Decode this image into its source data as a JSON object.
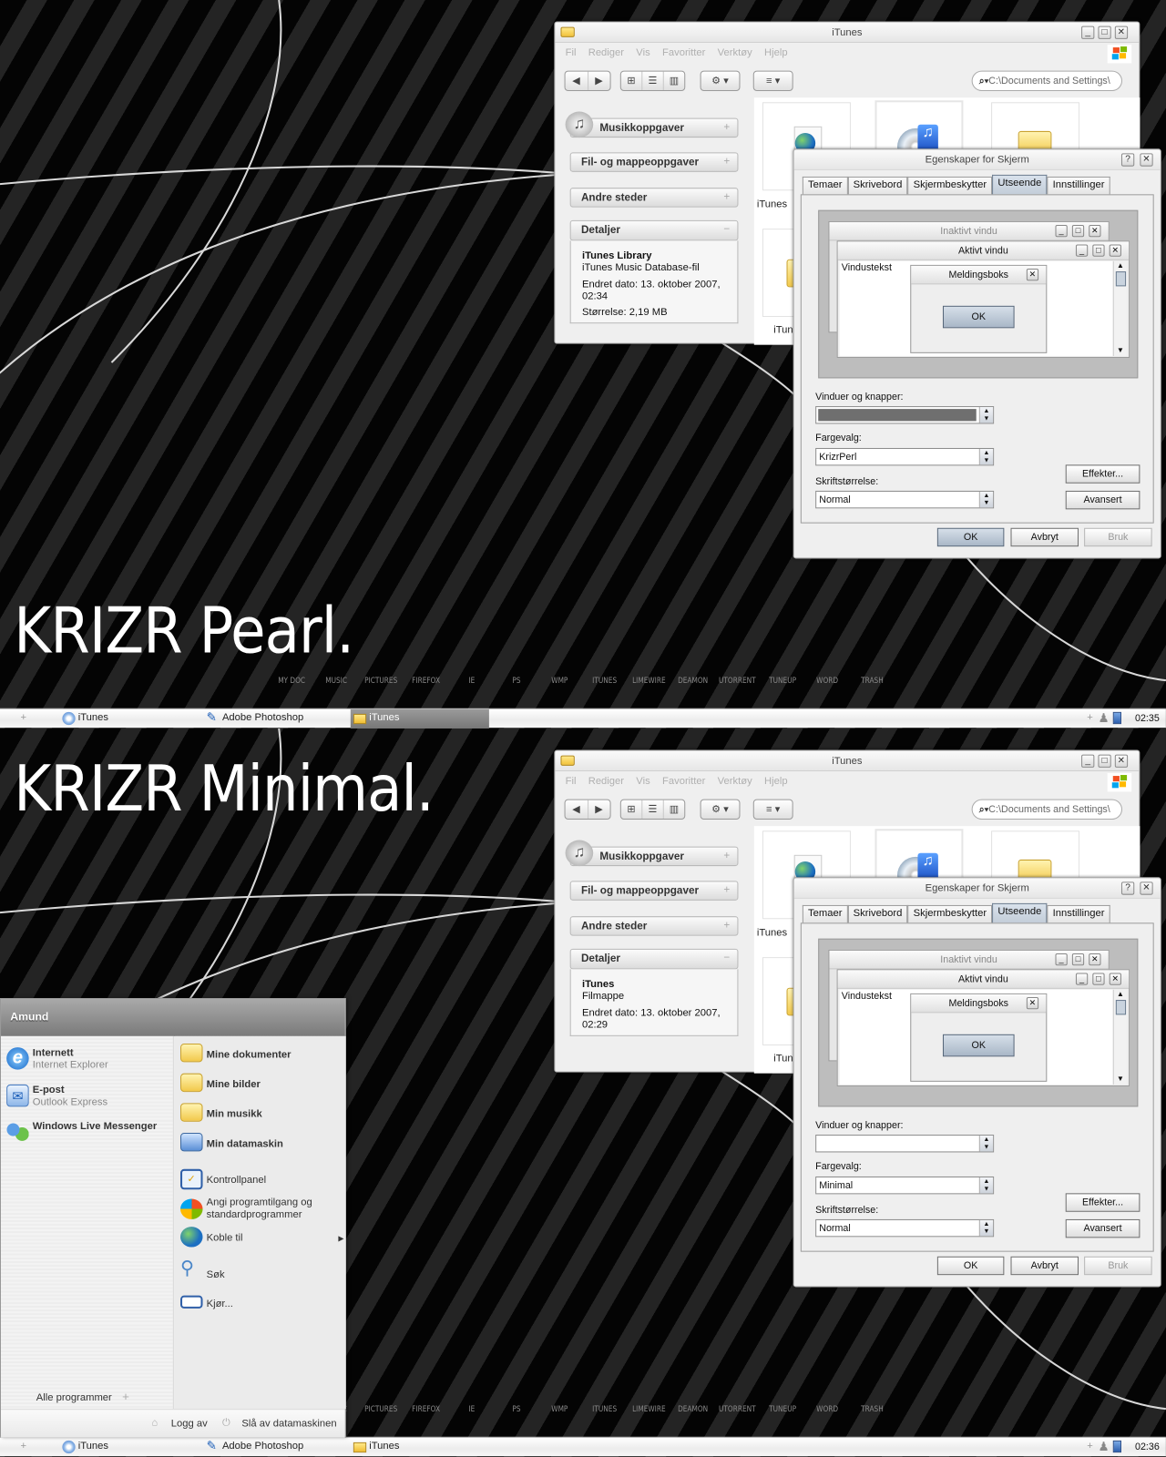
{
  "explorer": {
    "title": "iTunes",
    "menu": [
      "Fil",
      "Rediger",
      "Vis",
      "Favoritter",
      "Verktøy",
      "Hjelp"
    ],
    "search_value": "C:\\Documents and Settings\\",
    "tasks": [
      "Musikkoppgaver",
      "Fil- og mappeoppgaver",
      "Andre steder",
      "Detaljer"
    ],
    "file_caption": "iTunes"
  },
  "dialog": {
    "title": "Egenskaper for Skjerm",
    "tabs": [
      "Temaer",
      "Skrivebord",
      "Skjermbeskytter",
      "Utseende",
      "Innstillinger"
    ],
    "active_tab": 3,
    "preview": {
      "inactive": "Inaktivt vindu",
      "active": "Aktivt vindu",
      "window_text": "Vindustekst",
      "message_box": "Meldingsboks",
      "ok": "OK"
    },
    "windows_label": "Vinduer og knapper:",
    "color_label": "Fargevalg:",
    "font_label": "Skriftstørrelse:",
    "font_value": "Normal",
    "effects": "Effekter...",
    "advanced": "Avansert",
    "ok": "OK",
    "cancel": "Avbryt",
    "apply": "Bruk"
  },
  "dock": [
    "MY DOC",
    "MUSIC",
    "PICTURES",
    "FIREFOX",
    "IE",
    "PS",
    "WMP",
    "ITUNES",
    "LIMEWIRE",
    "DEAMON",
    "UTORRENT",
    "TUNEUP",
    "WORD",
    "TRASH"
  ],
  "taskbar": {
    "items": [
      "iTunes",
      "Adobe Photoshop",
      "iTunes"
    ]
  },
  "screens": [
    {
      "headline": "KRIZR Pearl.",
      "details": {
        "name": "iTunes Library",
        "type": "iTunes Music Database-fil",
        "modified": "Endret dato: 13. oktober 2007, 02:34",
        "size": "Størrelse: 2,19 MB"
      },
      "color_scheme": "KrizrPerl",
      "windows_select_fill": "#6f6f6f",
      "default_ok_highlighted": true,
      "taskbar_active_index": 2,
      "clock": "02:35"
    },
    {
      "headline": "KRIZR Minimal.",
      "details": {
        "name": "iTunes",
        "type": "Filmappe",
        "modified": "Endret dato: 13. oktober 2007, 02:29",
        "size": ""
      },
      "color_scheme": "Minimal",
      "windows_select_fill": "#ffffff",
      "default_ok_highlighted": false,
      "taskbar_active_index": null,
      "clock": "02:36"
    }
  ],
  "start_menu": {
    "user": "Amund",
    "pinned": [
      {
        "title": "Internett",
        "subtitle": "Internet Explorer"
      },
      {
        "title": "E-post",
        "subtitle": "Outlook Express"
      },
      {
        "title": "Windows Live Messenger",
        "subtitle": ""
      }
    ],
    "places": [
      "Mine dokumenter",
      "Mine bilder",
      "Min musikk",
      "Min datamaskin"
    ],
    "system": [
      "Kontrollpanel",
      "Angi programtilgang og standardprogrammer",
      "Koble til",
      "Søk",
      "Kjør..."
    ],
    "all_programs": "Alle programmer",
    "log_off": "Logg av",
    "shut_down": "Slå av datamaskinen"
  }
}
